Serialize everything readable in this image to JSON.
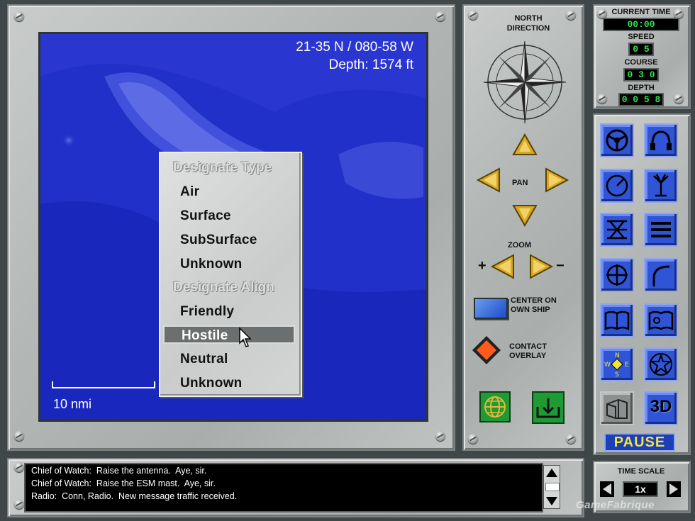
{
  "map": {
    "coordinates": "21-35 N / 080-58 W",
    "depth": "Depth: 1574 ft",
    "scale_label": "10 nmi"
  },
  "context_menu": {
    "header_type": "Designate Type",
    "type_items": [
      "Air",
      "Surface",
      "SubSurface",
      "Unknown"
    ],
    "header_align": "Designate Align",
    "align_items": [
      "Friendly",
      "Hostile",
      "Neutral",
      "Unknown"
    ],
    "selected": "Hostile"
  },
  "nav_panel": {
    "north_label_1": "NORTH",
    "north_label_2": "DIRECTION",
    "pan_label": "PAN",
    "zoom_label": "ZOOM",
    "zoom_in": "+",
    "zoom_out": "−",
    "center_label_1": "CENTER ON",
    "center_label_2": "OWN SHIP",
    "contact_label_1": "CONTACT",
    "contact_label_2": "OVERLAY"
  },
  "status": {
    "time_label": "CURRENT TIME",
    "time_value": "00:00",
    "speed_label": "SPEED",
    "speed_value": "0 5",
    "course_label": "COURSE",
    "course_value": "0 3 0",
    "depth_label": "DEPTH",
    "depth_value": "0 0 5 8"
  },
  "stations": {
    "pause_label": "PAUSE",
    "view3d_label": "3D"
  },
  "time_scale": {
    "label": "TIME SCALE",
    "value": "1x"
  },
  "messages": [
    "Chief of Watch:  Raise the antenna.  Aye, sir.",
    "Chief of Watch:  Raise the ESM mast.  Aye, sir.",
    "Radio:  Conn, Radio.  New message traffic received."
  ],
  "watermark": "GameFabrique",
  "colors": {
    "sea": "#1f2bc6",
    "station_button": "#2f55d6",
    "lcd_text": "#32e04a",
    "pause_text": "#f2e33a"
  }
}
